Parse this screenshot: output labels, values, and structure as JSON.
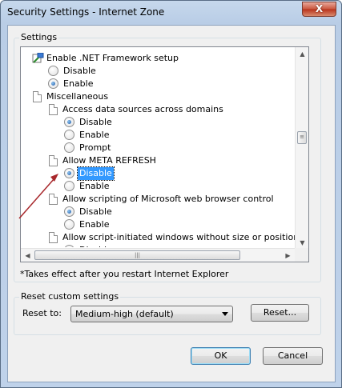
{
  "window": {
    "title": "Security Settings - Internet Zone",
    "close_label": "X"
  },
  "settings": {
    "legend": "Settings",
    "items": [
      {
        "kind": "header",
        "icon": "net-framework-icon",
        "label": "Enable .NET Framework setup"
      },
      {
        "kind": "option",
        "label": "Disable",
        "checked": false
      },
      {
        "kind": "option",
        "label": "Enable",
        "checked": true
      },
      {
        "kind": "header",
        "icon": "document-icon",
        "label": "Miscellaneous"
      },
      {
        "kind": "header",
        "icon": "document-icon",
        "label": "Access data sources across domains"
      },
      {
        "kind": "option",
        "label": "Disable",
        "checked": true
      },
      {
        "kind": "option",
        "label": "Enable",
        "checked": false
      },
      {
        "kind": "option",
        "label": "Prompt",
        "checked": false
      },
      {
        "kind": "header",
        "icon": "document-icon",
        "label": "Allow META REFRESH"
      },
      {
        "kind": "option",
        "label": "Disable",
        "checked": true,
        "selected": true
      },
      {
        "kind": "option",
        "label": "Enable",
        "checked": false
      },
      {
        "kind": "header",
        "icon": "document-icon",
        "label": "Allow scripting of Microsoft web browser control"
      },
      {
        "kind": "option",
        "label": "Disable",
        "checked": true
      },
      {
        "kind": "option",
        "label": "Enable",
        "checked": false
      },
      {
        "kind": "header",
        "icon": "document-icon",
        "label": "Allow script-initiated windows without size or position constra"
      },
      {
        "kind": "option",
        "label": "Disable",
        "checked": true
      }
    ],
    "note": "*Takes effect after you restart Internet Explorer"
  },
  "reset": {
    "legend": "Reset custom settings",
    "label": "Reset to:",
    "selected": "Medium-high (default)",
    "button": "Reset..."
  },
  "buttons": {
    "ok": "OK",
    "cancel": "Cancel"
  },
  "colors": {
    "selection": "#3399ff",
    "annotation_arrow": "#a8282c"
  }
}
